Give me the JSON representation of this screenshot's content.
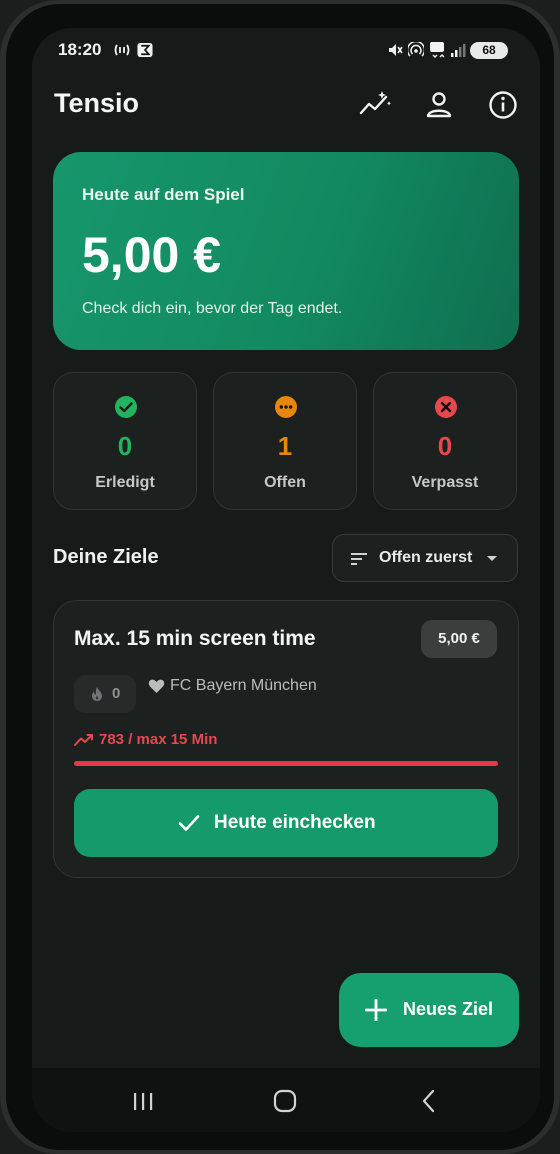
{
  "status_bar": {
    "time": "18:20",
    "battery": "68"
  },
  "app": {
    "title": "Tensio"
  },
  "hero": {
    "subtitle": "Heute auf dem Spiel",
    "amount": "5,00 €",
    "note": "Check dich ein, bevor der Tag endet."
  },
  "stats": [
    {
      "count": "0",
      "label": "Erledigt",
      "color": "#22b35e"
    },
    {
      "count": "1",
      "label": "Offen",
      "color": "#e8870e"
    },
    {
      "count": "0",
      "label": "Verpasst",
      "color": "#e5484d"
    }
  ],
  "goals_section": {
    "title": "Deine Ziele",
    "sort_label": "Offen zuerst"
  },
  "goal": {
    "title": "Max. 15 min screen time",
    "stake": "5,00 €",
    "streak": "0",
    "charity": "FC Bayern München",
    "progress_text": "783 / max 15 Min",
    "progress_fraction": 1.0,
    "checkin_label": "Heute einchecken"
  },
  "fab": {
    "label": "Neues Ziel"
  },
  "colors": {
    "accent": "#159a6c",
    "danger": "#e5484d",
    "warning": "#e8870e",
    "success": "#22b35e"
  }
}
